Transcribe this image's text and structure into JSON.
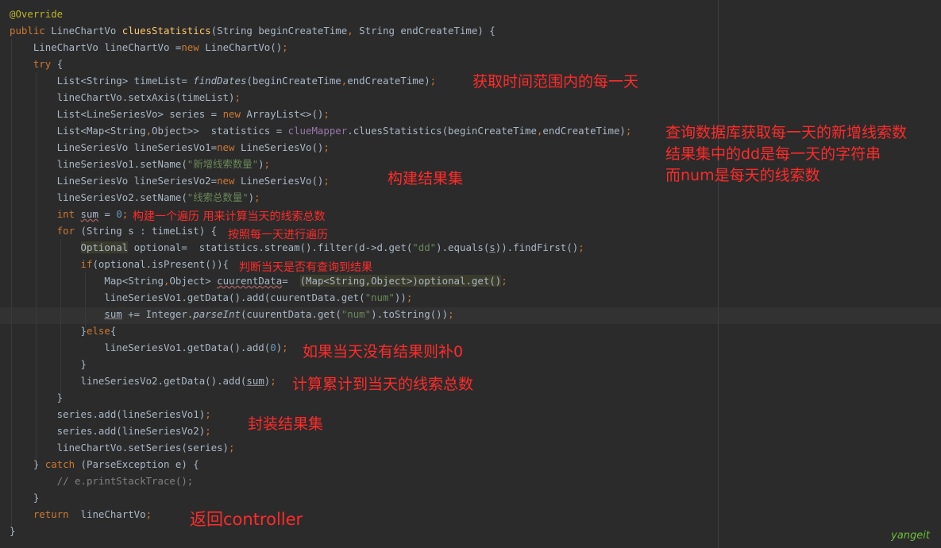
{
  "editor": {
    "lines": [
      [
        [
          "ann",
          "@Override"
        ]
      ],
      [
        [
          "kw",
          "public "
        ],
        [
          "p",
          "LineChartVo "
        ],
        [
          "fn",
          "cluesStatistics"
        ],
        [
          "p",
          "(String beginCreateTime"
        ],
        [
          "kw",
          ", "
        ],
        [
          "p",
          "String endCreateTime) {"
        ]
      ],
      [
        [
          "p",
          "    LineChartVo lineChartVo ="
        ],
        [
          "kw",
          "new "
        ],
        [
          "p",
          "LineChartVo()"
        ],
        [
          "kw",
          ";"
        ]
      ],
      [
        [
          "p",
          "    "
        ],
        [
          "kw",
          "try "
        ],
        [
          "p",
          "{"
        ]
      ],
      [
        [
          "p",
          "        List<String> timeList= "
        ],
        [
          "it",
          "findDates"
        ],
        [
          "p",
          "(beginCreateTime"
        ],
        [
          "kw",
          ","
        ],
        [
          "p",
          "endCreateTime)"
        ],
        [
          "kw",
          ";"
        ]
      ],
      [
        [
          "p",
          "        lineChartVo.setxAxis(timeList)"
        ],
        [
          "kw",
          ";"
        ]
      ],
      [
        [
          "p",
          "        List<LineSeriesVo> series = "
        ],
        [
          "kw",
          "new "
        ],
        [
          "p",
          "ArrayList<>()"
        ],
        [
          "kw",
          ";"
        ]
      ],
      [
        [
          "p",
          "        List<Map<String"
        ],
        [
          "kw",
          ","
        ],
        [
          "p",
          "Object>>  statistics = "
        ],
        [
          "var",
          "clueMapper"
        ],
        [
          "p",
          ".cluesStatistics(beginCreateTime"
        ],
        [
          "kw",
          ","
        ],
        [
          "p",
          "endCreateTime)"
        ],
        [
          "kw",
          ";"
        ]
      ],
      [
        [
          "p",
          "        LineSeriesVo lineSeriesVo1="
        ],
        [
          "kw",
          "new "
        ],
        [
          "p",
          "LineSeriesVo()"
        ],
        [
          "kw",
          ";"
        ]
      ],
      [
        [
          "p",
          "        lineSeriesVo1.setName("
        ],
        [
          "str",
          "\"新增线索数量\""
        ],
        [
          "p",
          ")"
        ],
        [
          "kw",
          ";"
        ]
      ],
      [
        [
          "p",
          "        LineSeriesVo lineSeriesVo2="
        ],
        [
          "kw",
          "new "
        ],
        [
          "p",
          "LineSeriesVo()"
        ],
        [
          "kw",
          ";"
        ]
      ],
      [
        [
          "p",
          "        lineSeriesVo2.setName("
        ],
        [
          "str",
          "\"线索总数量\""
        ],
        [
          "p",
          ")"
        ],
        [
          "kw",
          ";"
        ]
      ],
      [
        [
          "p",
          "        "
        ],
        [
          "kw",
          "int "
        ],
        [
          "wavy",
          "sum"
        ],
        [
          "p",
          " = "
        ],
        [
          "num",
          "0"
        ],
        [
          "kw",
          ";"
        ]
      ],
      [
        [
          "p",
          "        "
        ],
        [
          "kw",
          "for "
        ],
        [
          "p",
          "(String s : timeList) {"
        ]
      ],
      [
        [
          "p",
          "            "
        ],
        [
          "hl",
          "Optional"
        ],
        [
          "p",
          " optional=  statistics.stream().filter(d->d.get("
        ],
        [
          "str",
          "\"dd\""
        ],
        [
          "p",
          ").equals("
        ],
        [
          "ul",
          "s"
        ],
        [
          "p",
          ")).findFirst()"
        ],
        [
          "kw",
          ";"
        ]
      ],
      [
        [
          "p",
          "            "
        ],
        [
          "kw",
          "if"
        ],
        [
          "p",
          "(optional.isPresent()){"
        ]
      ],
      [
        [
          "p",
          "                Map<String"
        ],
        [
          "kw",
          ","
        ],
        [
          "p",
          "Object> "
        ],
        [
          "wavy",
          "cuurentData"
        ],
        [
          "p",
          "=  "
        ],
        [
          "hl",
          "(Map<String,Object>)optional.get()"
        ],
        [
          "kw",
          ";"
        ]
      ],
      [
        [
          "p",
          "                lineSeriesVo1.getData().add(cuurentData.get("
        ],
        [
          "str",
          "\"num\""
        ],
        [
          "p",
          "))"
        ],
        [
          "kw",
          ";"
        ]
      ],
      [
        [
          "p",
          "                "
        ],
        [
          "ul",
          "sum"
        ],
        [
          "p",
          " += Integer."
        ],
        [
          "it",
          "parseInt"
        ],
        [
          "p",
          "(cuurentData.get("
        ],
        [
          "str",
          "\"num\""
        ],
        [
          "p",
          ").toString())"
        ],
        [
          "kw",
          ";"
        ]
      ],
      [
        [
          "p",
          "            }"
        ],
        [
          "kw",
          "else"
        ],
        [
          "p",
          "{"
        ]
      ],
      [
        [
          "p",
          "                lineSeriesVo1.getData().add("
        ],
        [
          "num",
          "0"
        ],
        [
          "p",
          ")"
        ],
        [
          "kw",
          ";"
        ]
      ],
      [
        [
          "p",
          "            }"
        ]
      ],
      [
        [
          "p",
          "            lineSeriesVo2.getData().add("
        ],
        [
          "ul",
          "sum"
        ],
        [
          "p",
          ")"
        ],
        [
          "kw",
          ";"
        ]
      ],
      [
        [
          "p",
          "        }"
        ]
      ],
      [
        [
          "p",
          "        series.add(lineSeriesVo1)"
        ],
        [
          "kw",
          ";"
        ]
      ],
      [
        [
          "p",
          "        series.add(lineSeriesVo2)"
        ],
        [
          "kw",
          ";"
        ]
      ],
      [
        [
          "p",
          "        lineChartVo.setSeries(series)"
        ],
        [
          "kw",
          ";"
        ]
      ],
      [
        [
          "p",
          "    } "
        ],
        [
          "kw",
          "catch "
        ],
        [
          "p",
          "(ParseException e) {"
        ]
      ],
      [
        [
          "cmt",
          "        // e.printStackTrace();"
        ]
      ],
      [
        [
          "p",
          "    }"
        ]
      ],
      [
        [
          "p",
          "    "
        ],
        [
          "kw",
          "return  "
        ],
        [
          "p",
          "lineChartVo"
        ],
        [
          "kw",
          ";"
        ]
      ],
      [
        [
          "p",
          "}"
        ]
      ]
    ]
  },
  "annotations": {
    "time_range": "获取时间范围内的每一天",
    "query_db_1": "查询数据库获取每一天的新增线索数",
    "query_db_2": "结果集中的dd是每一天的字符串",
    "query_db_3": "而num是每天的线索数",
    "build_result": "构建结果集",
    "build_iter": "构建一个遍历 用来计算当天的线索总数",
    "iterate_days": "按照每一天进行遍历",
    "check_query": "判断当天是否有查询到结果",
    "fill_zero": "如果当天没有结果则补0",
    "accumulate": "计算累计到当天的线索总数",
    "wrap_result": "封装结果集",
    "return_ctrl": "返回controller"
  },
  "watermark": "yangeit",
  "colors": {
    "background": "#2b2b2b",
    "annotation": "#ff2b2b",
    "keyword": "#cc7832",
    "string": "#6a8759",
    "number": "#6897bb",
    "annotation_tag": "#bbb529",
    "method_decl": "#ffc66d",
    "field": "#9876aa",
    "comment": "#808080",
    "plain": "#a9b7c6"
  }
}
